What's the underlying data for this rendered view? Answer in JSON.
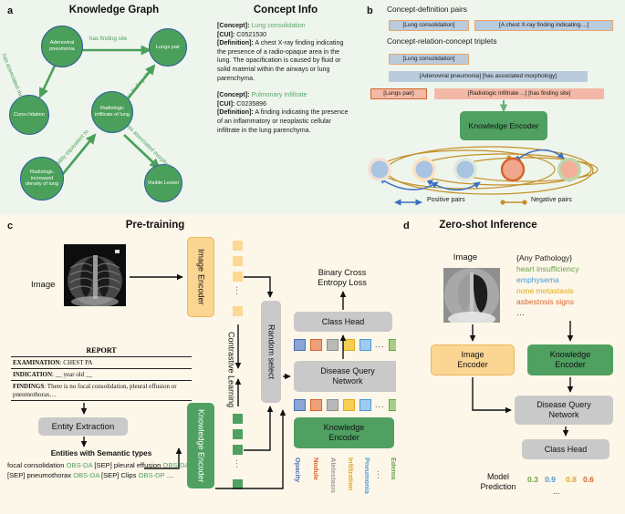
{
  "panels": {
    "a": {
      "label": "a",
      "title_kg": "Knowledge Graph",
      "title_ci": "Concept Info"
    },
    "b": {
      "label": "b"
    },
    "c": {
      "label": "c",
      "title": "Pre-training"
    },
    "d": {
      "label": "d",
      "title": "Zero-shot Inference"
    }
  },
  "knowledge_graph": {
    "nodes": [
      {
        "id": "adenoviral",
        "label": "Adenoviral pneumonia"
      },
      {
        "id": "lungs_pair",
        "label": "Lungs pair"
      },
      {
        "id": "consolidation",
        "label": "Consolidation"
      },
      {
        "id": "radiologic_infiltrate",
        "label": "Radiologic infiltrate of lung"
      },
      {
        "id": "radiologic_density",
        "label": "Radiologic increased density of lung"
      },
      {
        "id": "visible_lesion",
        "label": "Visible Lesion"
      }
    ],
    "edges": [
      {
        "label": "has finding site",
        "from": "adenoviral",
        "to": "lungs_pair"
      },
      {
        "label": "has associated morphology",
        "from": "adenoviral",
        "to": "consolidation"
      },
      {
        "label": "has finding site",
        "from": "radiologic_infiltrate",
        "to": "lungs_pair"
      },
      {
        "label": "possibly equivalent to",
        "from": "radiologic_density",
        "to": "radiologic_infiltrate"
      },
      {
        "label": "has associated morphology",
        "from": "radiologic_infiltrate",
        "to": "visible_lesion"
      }
    ],
    "node_fill": "#4aa05a",
    "node_stroke": "#2b5b9e",
    "edge_color": "#4aa05a"
  },
  "concept_info": {
    "entries": [
      {
        "concept_key": "[Concept]:",
        "concept_value": "Lung consolidation",
        "cui_key": "[CUI]:",
        "cui_value": "C0521530",
        "def_key": "[Definition]:",
        "def_value": "A chest X-ray finding indicating the presence of a radio-opaque area in the lung. The opacification is caused by fluid or solid material within the airways or lung parenchyma."
      },
      {
        "concept_key": "[Concept]:",
        "concept_value": "Pulmonary Infiltrate",
        "cui_key": "[CUI]:",
        "cui_value": "C0235896",
        "def_key": "[Definition]:",
        "def_value": "A finding indicating the presence of an inflammatory or neoplastic cellular infiltrate in the lung parenchyma."
      }
    ]
  },
  "panel_b": {
    "heading_pairs": "Concept-definition pairs",
    "heading_triplets": "Concept-relation-concept triplets",
    "pair_row": [
      {
        "text": "[Lung consolidation]",
        "style": "blue"
      },
      {
        "text": "[A chest X-ray finding indicating....]",
        "style": "blue"
      }
    ],
    "triplet_rows": [
      [
        {
          "text": "[Lung consolidation]",
          "style": "blue"
        }
      ],
      [
        {
          "text": "[Adenoviral pneumonia]  [has associated morphology]",
          "style": "blue-nb"
        }
      ],
      [
        {
          "text": "[Lungs pair]",
          "style": "salmon-b"
        },
        {
          "text": "[Radiologic infiltrate ...] [has finding site]",
          "style": "salmon"
        }
      ]
    ],
    "knowledge_encoder": "Knowledge\nEncoder",
    "knowledge_encoder_l1": "Knowledge",
    "knowledge_encoder_l2": "Encoder",
    "legend": {
      "positive": "Positive pairs",
      "negative": "Negative pairs",
      "positive_color": "#3b6fc4",
      "negative_color": "#c4902a"
    },
    "embedding_circles": [
      {
        "fill": "#a9c4e2",
        "ring": "#f3e0d4"
      },
      {
        "fill": "#a9c4e2",
        "ring": "#fbe3c0"
      },
      {
        "fill": "#a9c4e2",
        "ring": "#dfe9da"
      },
      {
        "fill": "#f0a78e",
        "ring": "#d4642a"
      },
      {
        "fill": "#f2b09a",
        "ring": "#bcd6ad"
      }
    ]
  },
  "panel_c": {
    "image_label": "Image",
    "image_encoder_l1": "Image",
    "image_encoder_l2": "Encoder",
    "knowledge_encoder_label": "Knowledge Encoder",
    "knowledge_encoder_vert": "Encoder",
    "contrastive_l1": "Contrastive",
    "contrastive_l2": "Learning",
    "random_select": "Random select",
    "class_head": "Class Head",
    "loss_l1": "Binary Cross",
    "loss_l2": "Entropy Loss",
    "dqn_l1": "Disease Query",
    "dqn_l2": "Network",
    "ke_l1": "Knowledge",
    "ke_l2": "Encoder",
    "entity_extraction": "Entity Extraction",
    "entities_title": "Entities with Semantic types",
    "report": {
      "title": "REPORT",
      "rows": [
        {
          "key": "EXAMINATION",
          "value": ": CHEST PA"
        },
        {
          "key": "INDICATION",
          "value": ":  __ year old __"
        },
        {
          "key": "FINDINGS",
          "value": ": There is no focal consolidation, pleural effusion or pneumothorax…"
        }
      ]
    },
    "entities_tokens": [
      {
        "t": "focal consolidation ",
        "k": "plain"
      },
      {
        "t": "OBS-DA",
        "k": "sem"
      },
      {
        "t": " [SEP] pleural effusion ",
        "k": "plain"
      },
      {
        "t": "OBS-DA",
        "k": "sem"
      },
      {
        "t": " [SEP] pneumothorax ",
        "k": "plain"
      },
      {
        "t": "OBS-DA",
        "k": "sem"
      },
      {
        "t": " [SEP] Clips ",
        "k": "plain"
      },
      {
        "t": "OBS-DP",
        "k": "sem"
      },
      {
        "t": " …",
        "k": "plain"
      }
    ],
    "disease_labels": [
      {
        "text": "Opacity",
        "color": "#4a6fb5"
      },
      {
        "text": "Nodule",
        "color": "#d9642d"
      },
      {
        "text": "Atelectasis",
        "color": "#9a9a9a"
      },
      {
        "text": "Infiltration",
        "color": "#e0a91f"
      },
      {
        "text": "Pneumonia",
        "color": "#4c9ad6"
      },
      {
        "text": "Edema",
        "color": "#6ba148"
      }
    ],
    "ellipsis": "...",
    "cell_row": [
      "blue",
      "orange",
      "grey",
      "yellow",
      "lblue",
      "green"
    ]
  },
  "panel_d": {
    "image_label": "Image",
    "image_encoder_l1": "Image",
    "image_encoder_l2": "Encoder",
    "ke_l1": "Knowledge",
    "ke_l2": "Encoder",
    "dqn_l1": "Disease Query",
    "dqn_l2": "Network",
    "class_head": "Class Head",
    "prediction_label_l1": "Model",
    "prediction_label_l2": "Prediction",
    "pathology_header": "{Any Pathology}",
    "pathologies": [
      {
        "text": "heart insufficiency",
        "color": "#6ba148"
      },
      {
        "text": "emphysema",
        "color": "#4c9ad6"
      },
      {
        "text": "none metastasis",
        "color": "#e0a91f"
      },
      {
        "text": "asbestosis signs",
        "color": "#d9642d"
      }
    ],
    "pathology_ellipsis": "…",
    "predictions": [
      {
        "value": "0.3",
        "color": "#6ba148"
      },
      {
        "value": "0.9",
        "color": "#4c9ad6"
      },
      {
        "value": "0.8",
        "color": "#e0a91f"
      },
      {
        "value": "0.6",
        "color": "#d9642d"
      }
    ],
    "prediction_ellipsis": "..."
  }
}
